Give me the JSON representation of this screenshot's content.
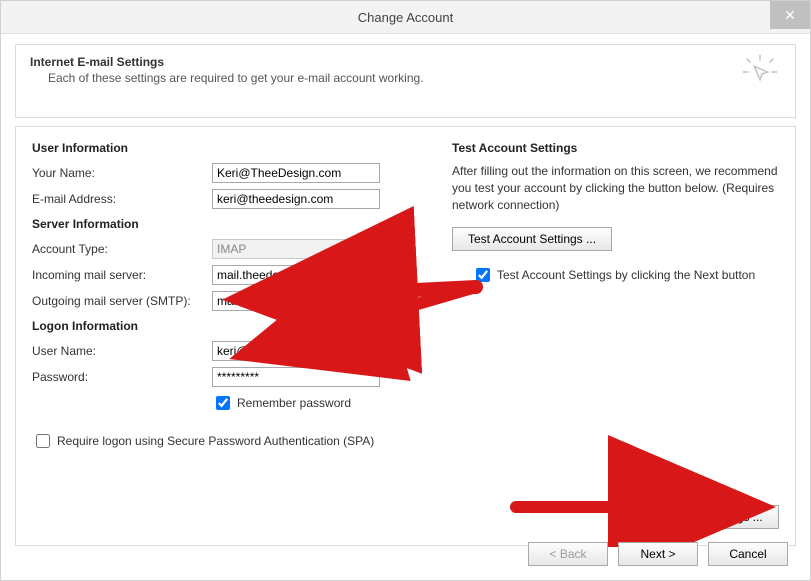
{
  "window": {
    "title": "Change Account"
  },
  "header": {
    "title": "Internet E-mail Settings",
    "subtitle": "Each of these settings are required to get your e-mail account working."
  },
  "sections": {
    "user_info": "User Information",
    "server_info": "Server Information",
    "logon_info": "Logon Information",
    "test_title": "Test Account Settings"
  },
  "labels": {
    "your_name": "Your Name:",
    "email": "E-mail Address:",
    "account_type": "Account Type:",
    "incoming": "Incoming mail server:",
    "outgoing": "Outgoing mail server (SMTP):",
    "user_name": "User Name:",
    "password": "Password:",
    "remember": "Remember password",
    "spa": "Require logon using Secure Password Authentication (SPA)",
    "test_desc": "After filling out the information on this screen, we recommend you test your account by clicking the button below. (Requires network connection)",
    "test_btn": "Test Account Settings ...",
    "test_chk": "Test Account Settings by clicking the Next button",
    "more": "More Settings ...",
    "back": "< Back",
    "next": "Next >",
    "cancel": "Cancel"
  },
  "values": {
    "your_name": "Keri@TheeDesign.com",
    "email": "keri@theedesign.com",
    "account_type": "IMAP",
    "incoming": "mail.theedesign.com",
    "outgoing": "mail.theedesign.com",
    "user_name": "keri@theedesign.com",
    "password": "*********",
    "remember_checked": true,
    "spa_checked": false,
    "test_checked": true
  }
}
